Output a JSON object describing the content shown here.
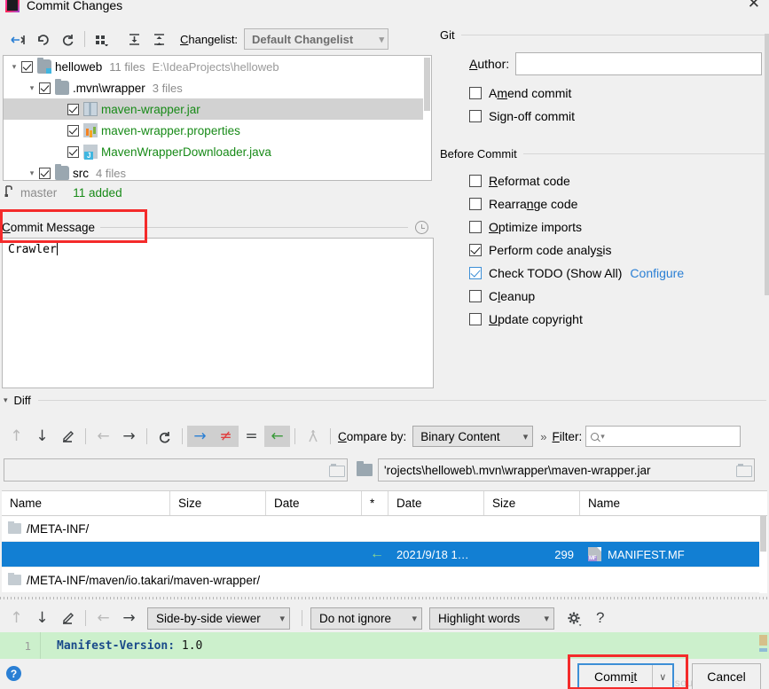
{
  "window": {
    "title": "Commit Changes",
    "close_label": "✕",
    "app_icon": "intellij-idea-icon"
  },
  "toolbar": {
    "buttons": [
      {
        "name": "collapse-to-selection",
        "glyph": "→←"
      },
      {
        "name": "revert",
        "glyph": "↶"
      },
      {
        "name": "refresh",
        "glyph": "↻"
      },
      {
        "name": "group-by",
        "glyph": "∷"
      },
      {
        "name": "expand-all",
        "glyph": "⤓"
      },
      {
        "name": "collapse-all",
        "glyph": "⤒"
      }
    ],
    "changelist_label": "Changelist:",
    "changelist_accel": "C",
    "changelist_value": "Default Changelist"
  },
  "tree": {
    "rows": [
      {
        "indent": 0,
        "arrow": "▾",
        "checked": true,
        "icon": "folder-module-icon",
        "name": "helloweb",
        "name_color": "black",
        "meta": "11 files",
        "path": "E:\\IdeaProjects\\helloweb",
        "selected": false
      },
      {
        "indent": 1,
        "arrow": "▾",
        "checked": true,
        "icon": "folder-icon",
        "name": ".mvn\\wrapper",
        "name_color": "black",
        "meta": "3 files",
        "path": "",
        "selected": false
      },
      {
        "indent": 2,
        "arrow": "",
        "checked": true,
        "icon": "jar-file-icon",
        "name": "maven-wrapper.jar",
        "name_color": "green",
        "meta": "",
        "path": "",
        "selected": true
      },
      {
        "indent": 2,
        "arrow": "",
        "checked": true,
        "icon": "properties-file-icon",
        "name": "maven-wrapper.properties",
        "name_color": "green",
        "meta": "",
        "path": "",
        "selected": false
      },
      {
        "indent": 2,
        "arrow": "",
        "checked": true,
        "icon": "java-file-icon",
        "name": "MavenWrapperDownloader.java",
        "name_color": "green",
        "meta": "",
        "path": "",
        "selected": false
      },
      {
        "indent": 1,
        "arrow": "▾",
        "checked": true,
        "icon": "folder-icon",
        "name": "src",
        "name_color": "black",
        "meta": "4 files",
        "path": "",
        "selected": false
      }
    ]
  },
  "branch": {
    "icon": "git-branch-icon",
    "name": "master",
    "status": "11 added"
  },
  "commit_message": {
    "label": "Commit Message",
    "label_accel": "C",
    "history_icon": "clock-history-icon",
    "value": "Crawler"
  },
  "git_panel": {
    "title": "Git",
    "author_label": "Author:",
    "author_accel": "A",
    "author_value": "",
    "options": [
      {
        "label": "Amend commit",
        "accel": "m",
        "checked": false
      },
      {
        "label": "Sign-off commit",
        "accel": "g",
        "checked": false
      }
    ]
  },
  "before_commit": {
    "title": "Before Commit",
    "options": [
      {
        "label": "Reformat code",
        "accel": "R",
        "checked": false,
        "link": ""
      },
      {
        "label": "Rearrange code",
        "accel": "n",
        "checked": false,
        "link": ""
      },
      {
        "label": "Optimize imports",
        "accel": "O",
        "checked": false,
        "link": ""
      },
      {
        "label": "Perform code analysis",
        "accel": "s",
        "checked": true,
        "link": ""
      },
      {
        "label": "Check TODO (Show All)",
        "accel": "",
        "checked": true,
        "link": "Configure"
      },
      {
        "label": "Cleanup",
        "accel": "l",
        "checked": false,
        "link": ""
      },
      {
        "label": "Update copyright",
        "accel": "U",
        "checked": false,
        "link": ""
      }
    ]
  },
  "diff_section": {
    "title": "Diff",
    "toolbar_buttons": [
      {
        "name": "previous-difference",
        "glyph": "↑",
        "state": "dim"
      },
      {
        "name": "next-difference",
        "glyph": "↓",
        "state": "normal"
      },
      {
        "name": "edit-source",
        "glyph": "✎",
        "state": "normal"
      },
      {
        "name": "previous-file",
        "glyph": "←",
        "state": "dim"
      },
      {
        "name": "next-file",
        "glyph": "→",
        "state": "normal"
      },
      {
        "name": "refresh-diff",
        "glyph": "↻",
        "state": "normal"
      },
      {
        "name": "show-new-files",
        "glyph": "→",
        "state": "highlight-blue"
      },
      {
        "name": "show-modified-files",
        "glyph": "≠",
        "state": "highlight-red"
      },
      {
        "name": "show-equal-files",
        "glyph": "=",
        "state": "normal"
      },
      {
        "name": "show-deleted-files",
        "glyph": "←",
        "state": "highlight-green"
      },
      {
        "name": "synchronize",
        "glyph": "⤴",
        "state": "dim"
      }
    ],
    "compare_by_label": "Compare by:",
    "compare_by_accel": "C",
    "compare_by_value": "Binary Content",
    "more_glyph": "»",
    "filter_label": "Filter:",
    "filter_accel": "F",
    "filter_value": "",
    "left_path": "",
    "right_path": "'rojects\\helloweb\\.mvn\\wrapper\\maven-wrapper.jar"
  },
  "file_table": {
    "headers": [
      "Name",
      "Size",
      "Date",
      "*",
      "Date",
      "Size",
      "Name"
    ],
    "rows": [
      {
        "type": "folder",
        "label": "/META-INF/",
        "selected": false,
        "left_name": "",
        "left_size": "",
        "left_date": "",
        "marker": "",
        "right_date": "",
        "right_size": "",
        "right_name": ""
      },
      {
        "type": "file",
        "label": "",
        "selected": true,
        "left_name": "",
        "left_size": "",
        "left_date": "",
        "marker": "←",
        "right_date": "2021/9/18 1…",
        "right_size": "299",
        "right_name": "MANIFEST.MF"
      },
      {
        "type": "folder",
        "label": "/META-INF/maven/io.takari/maven-wrapper/",
        "selected": false,
        "left_name": "",
        "left_size": "",
        "left_date": "",
        "marker": "",
        "right_date": "",
        "right_size": "",
        "right_name": ""
      }
    ]
  },
  "diff_viewer": {
    "toolbar_buttons": [
      {
        "name": "previous-difference",
        "glyph": "↑",
        "state": "dim"
      },
      {
        "name": "next-difference",
        "glyph": "↓",
        "state": "normal"
      },
      {
        "name": "edit-source",
        "glyph": "✎",
        "state": "normal"
      },
      {
        "name": "previous-change",
        "glyph": "←",
        "state": "dim"
      },
      {
        "name": "next-change",
        "glyph": "→",
        "state": "normal"
      }
    ],
    "viewer_mode": "Side-by-side viewer",
    "whitespace_mode": "Do not ignore",
    "highlight_mode": "Highlight words",
    "settings_icon": "gear-icon",
    "help_glyph": "?",
    "line_number": "1",
    "code_key": "Manifest-Version:",
    "code_value": "1.0"
  },
  "footer": {
    "help_glyph": "?",
    "commit_label": "Commit",
    "commit_accel": "i",
    "commit_dropdown_glyph": "∨",
    "cancel_label": "Cancel",
    "watermark": "CSDN @kyusou_t"
  },
  "colors": {
    "accent_blue": "#127fd3",
    "link_blue": "#2a7fd4",
    "added_green": "#178a17",
    "diff_green_bg": "#ccf0cc",
    "annotation_red": "#f42b2b",
    "panel_bg": "#f0f0f0"
  }
}
